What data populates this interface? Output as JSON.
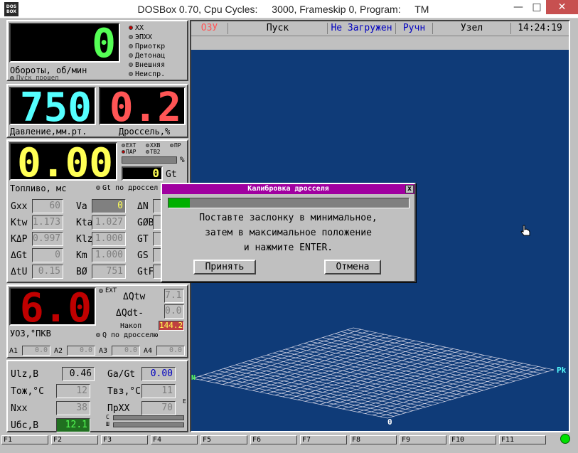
{
  "window": {
    "logo": "DOS BOX",
    "title_parts": [
      "DOSBox 0.70, Cpu Cycles:",
      "3000, Frameskip 0, Program:",
      "TM"
    ],
    "btn_min": "—",
    "btn_max": "□",
    "btn_close": "✕"
  },
  "rpm": {
    "value": "0",
    "label": "Обороты, об/мин",
    "start_label": "Пуск прошел",
    "modes": [
      {
        "label": "XX",
        "active": true
      },
      {
        "label": "ЭПХХ",
        "active": false
      },
      {
        "label": "Приоткр",
        "active": false
      },
      {
        "label": "Детонац",
        "active": false
      },
      {
        "label": "Внешняя",
        "active": false
      },
      {
        "label": "Неиспр.",
        "active": false
      }
    ]
  },
  "pressure": {
    "value": "750",
    "label": "Давление,мм.рт."
  },
  "throttle": {
    "value": "0.2",
    "label": "Дроссель,%"
  },
  "fuel": {
    "value": "0.00",
    "label": "Топливо, мс",
    "gt_value": "0",
    "gt_label": "Gt",
    "percent_label": "%",
    "gt_by_label": "Gt по дроссел",
    "opts": [
      {
        "label": "EXT",
        "active": false
      },
      {
        "label": "XXB",
        "active": false
      },
      {
        "label": "ПР",
        "active": false
      },
      {
        "label": "ПАР",
        "active": true
      },
      {
        "label": "TB2",
        "active": false
      }
    ]
  },
  "params": [
    {
      "label": "Gxx",
      "value": "60"
    },
    {
      "label": "Va",
      "value": "0"
    },
    {
      "label": "ΔN",
      "value": ""
    },
    {
      "label": "Ktw",
      "value": "1.173"
    },
    {
      "label": "Kta",
      "value": "1.027"
    },
    {
      "label": "GØB",
      "value": ""
    },
    {
      "label": "KΔP",
      "value": "0.997"
    },
    {
      "label": "Klz",
      "value": "1.000"
    },
    {
      "label": "GT",
      "value": ""
    },
    {
      "label": "ΔGt",
      "value": "0"
    },
    {
      "label": "Km",
      "value": "1.000"
    },
    {
      "label": "GS",
      "value": ""
    },
    {
      "label": "ΔtU",
      "value": "0.15"
    },
    {
      "label": "BØ",
      "value": "751"
    },
    {
      "label": "GtF",
      "value": ""
    }
  ],
  "uoz": {
    "value": "6.0",
    "label": "УОЗ,°ПКВ",
    "ext_label": "EXT",
    "q_label": "Q по дросселю",
    "dqtw_label": "ΔQtw",
    "dqtw_value": "7.1",
    "dqdt_label": "ΔQdt-",
    "dqdt_value": "0.0",
    "nakop_label": "Накоп",
    "nakop_value": "144.2",
    "a": [
      {
        "label": "A1",
        "value": "0.0"
      },
      {
        "label": "A2",
        "value": "0.0"
      },
      {
        "label": "A3",
        "value": "0.0"
      },
      {
        "label": "A4",
        "value": "0.0"
      }
    ]
  },
  "sensors": [
    {
      "label": "Ulz,B",
      "value": "0.46"
    },
    {
      "label": "Ga/Gt",
      "value": "0.00"
    },
    {
      "label": "Tож,°C",
      "value": "12"
    },
    {
      "label": "Tвз,°C",
      "value": "11"
    },
    {
      "label": "Nxx",
      "value": "38"
    },
    {
      "label": "ПрXX",
      "value": "70"
    },
    {
      "label": "Uбс,B",
      "value": "12.1"
    }
  ],
  "sensor_extra": {
    "e_label": "E",
    "c_label": "C",
    "sh_label": "Ш"
  },
  "status": {
    "ozu": "ОЗУ",
    "pusk": "Пуск",
    "loaded": "Не Загружен",
    "mode": "Ручн",
    "node": "Узел",
    "time": "14:24:19"
  },
  "plot": {
    "axis_zero": "0",
    "axis_pk": "Pk",
    "axis_n": "N"
  },
  "fkeys": [
    "F1",
    "F2",
    "F3",
    "F4",
    "F5",
    "F6",
    "F7",
    "F8",
    "F9",
    "F10",
    "F11"
  ],
  "dialog": {
    "title": "Калибровка дросселя",
    "close": "x",
    "progress": 0.09,
    "lines": [
      "Поставте заслонку в минимальное,",
      "затем в максимальное положение",
      "и нажмите ENTER."
    ],
    "ok": "Принять",
    "cancel": "Отмена"
  },
  "colors": {
    "green": "#55ff55",
    "cyan": "#55ffff",
    "red": "#ff5555",
    "yellow": "#ffff55",
    "darkred": "#c00000",
    "plot_bg": "#0f3b78"
  }
}
